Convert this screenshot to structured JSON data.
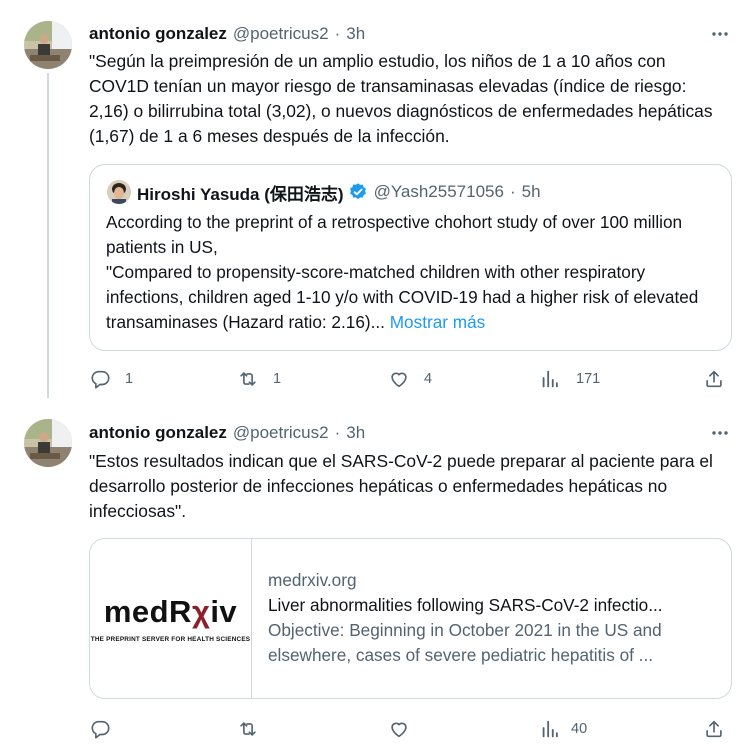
{
  "tweets": [
    {
      "author_name": "antonio gonzalez",
      "handle": "@poetricus2",
      "separator": "·",
      "time": "3h",
      "text": "\"Según la preimpresión de un amplio estudio, los niños de 1 a 10 años con COV1D tenían un mayor riesgo de transaminasas elevadas (índice de riesgo: 2,16) o bilirrubina total (3,02), o nuevos diagnósticos de enfermedades hepáticas (1,67) de 1 a 6 meses después de la infección.",
      "quote": {
        "author_name": "Hiroshi Yasuda (保田浩志)",
        "handle": "@Yash25571056",
        "separator": "·",
        "time": "5h",
        "text": "According to the preprint of a retrospective chohort study of over 100 million patients in US,\n\"Compared to propensity-score-matched children with other respiratory infections, children aged 1-10 y/o with COVID-19 had a higher risk of elevated transaminases (Hazard ratio: 2.16)...",
        "show_more": "Mostrar más"
      },
      "actions": {
        "replies": "1",
        "reposts": "1",
        "likes": "4",
        "views": "171"
      }
    },
    {
      "author_name": "antonio gonzalez",
      "handle": "@poetricus2",
      "separator": "·",
      "time": "3h",
      "text": "\"Estos resultados indican que el SARS-CoV-2 puede preparar al paciente para el desarrollo posterior de infecciones hepáticas o enfermedades hepáticas no infecciosas\".",
      "card": {
        "logo_pre": "medR",
        "logo_chi": "χ",
        "logo_post": "iv",
        "tagline": "THE PREPRINT SERVER FOR HEALTH SCIENCES",
        "domain": "medrxiv.org",
        "title": "Liver abnormalities following SARS-CoV-2 infectio...",
        "description": "Objective: Beginning in October 2021 in the US and elsewhere, cases of severe pediatric hepatitis of ..."
      },
      "actions": {
        "replies": "",
        "reposts": "",
        "likes": "",
        "views": "40"
      }
    }
  ],
  "colors": {
    "text": "#0f1419",
    "secondary": "#536471",
    "border": "#cfd9de",
    "link": "#1d9bf0",
    "verified": "#1d9bf0",
    "medrxiv_r": "#8b1f2a"
  },
  "icons": [
    "more-icon",
    "verified-badge-icon",
    "reply-icon",
    "repost-icon",
    "like-icon",
    "views-icon",
    "share-icon"
  ]
}
